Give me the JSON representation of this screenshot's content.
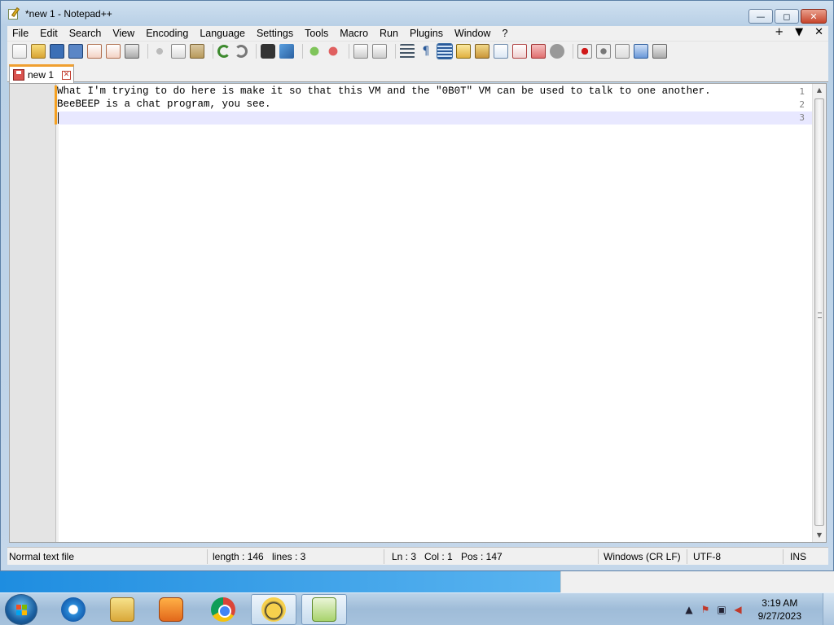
{
  "window": {
    "title": "*new 1 - Notepad++",
    "buttons": {
      "minimize": "—",
      "maximize": "◻",
      "close": "✕"
    }
  },
  "menubar": {
    "items": [
      "File",
      "Edit",
      "Search",
      "View",
      "Encoding",
      "Language",
      "Settings",
      "Tools",
      "Macro",
      "Run",
      "Plugins",
      "Window",
      "?"
    ],
    "right": [
      "+",
      "▼",
      "✕"
    ]
  },
  "toolbar": {
    "icons": [
      "new-file-icon",
      "open-file-icon",
      "save-icon",
      "save-all-icon",
      "close-icon",
      "close-all-icon",
      "print-icon",
      "cut-icon",
      "copy-icon",
      "paste-icon",
      "undo-icon",
      "redo-icon",
      "find-icon",
      "replace-icon",
      "zoom-in-icon",
      "zoom-out-icon",
      "sync-vertical-icon",
      "sync-horizontal-icon",
      "word-wrap-icon",
      "show-all-chars-icon",
      "indent-guide-icon",
      "user-language-icon",
      "doc-map-icon",
      "function-list-icon",
      "folder-workspace-icon",
      "monitoring-icon",
      "record-macro-icon",
      "stop-record-icon",
      "play-macro-icon",
      "run-multiple-icon",
      "save-macro-icon"
    ],
    "active_icon": "indent-guide-icon"
  },
  "tabs": [
    {
      "label": "new 1",
      "close": "✕"
    }
  ],
  "editor": {
    "line_numbers": [
      "1",
      "2",
      "3"
    ],
    "lines": [
      "What I'm trying to do here is make it so that this VM and the \"0B0T\" VM can be used to talk to one another.",
      "BeeBEEP is a chat program, you see.",
      ""
    ]
  },
  "statusbar": {
    "file_type": "Normal text file",
    "length": "length : 146",
    "lines": "lines : 3",
    "ln": "Ln : 3",
    "col": "Col : 1",
    "pos": "Pos : 147",
    "eol": "Windows (CR LF)",
    "encoding": "UTF-8",
    "mode": "INS"
  },
  "taskbar": {
    "apps": [
      "internet-explorer-icon",
      "windows-explorer-icon",
      "media-player-icon",
      "chrome-icon",
      "beebeep-icon",
      "notepad-plus-plus-icon"
    ],
    "clock_time": "3:19 AM",
    "clock_date": "9/27/2023",
    "tray": {
      "expand": "▲"
    }
  }
}
